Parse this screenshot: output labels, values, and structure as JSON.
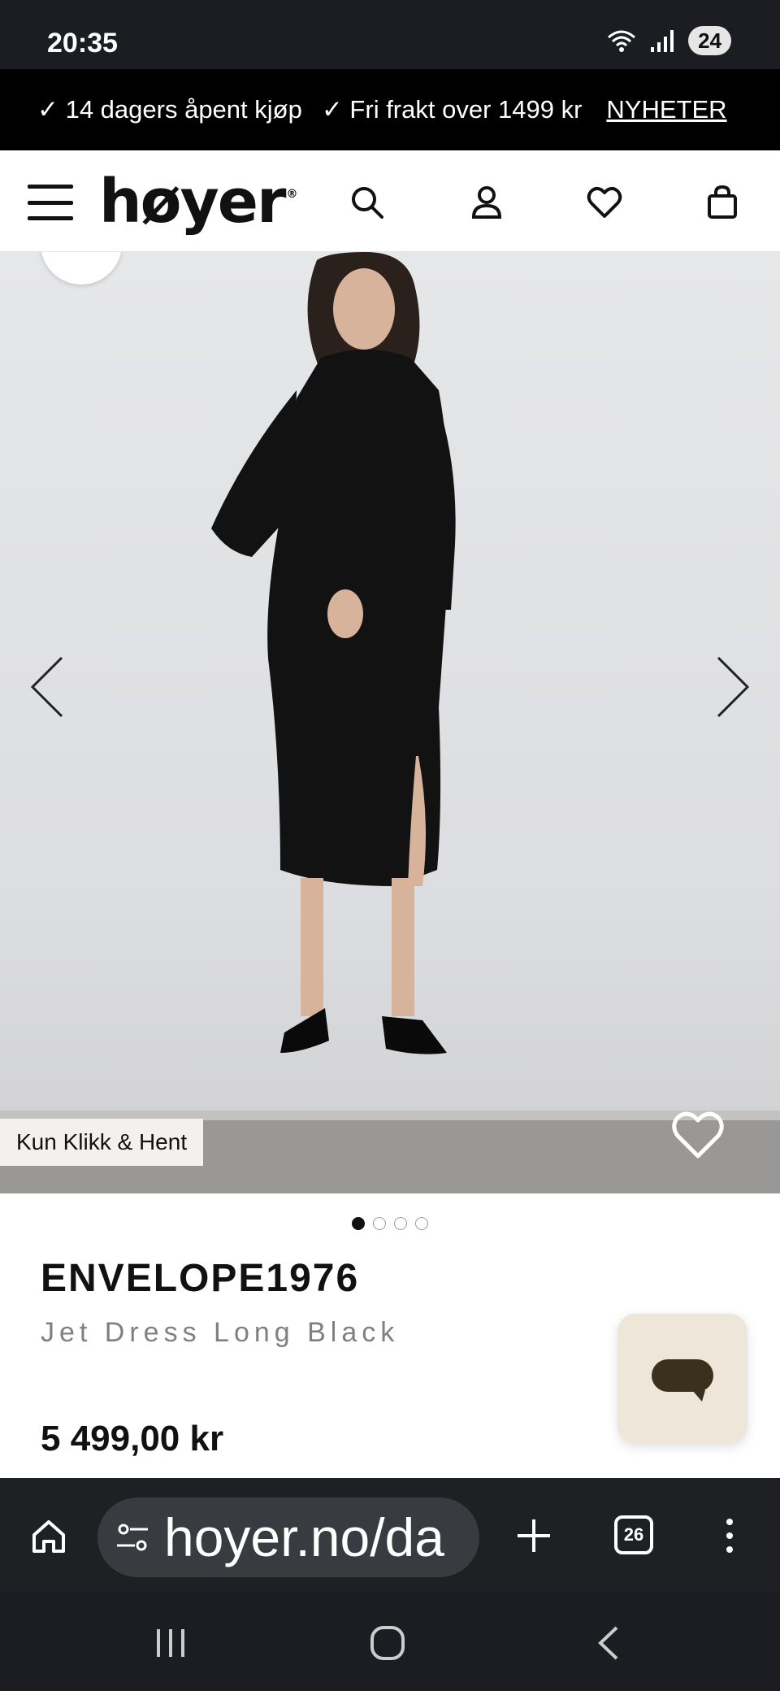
{
  "status_bar": {
    "time": "20:35",
    "battery": "24"
  },
  "announcement": {
    "msg1": "✓ 14 dagers åpent kjøp",
    "msg2": "✓ Fri frakt over 1499 kr",
    "link": "NYHETER"
  },
  "header": {
    "logo": "høyer",
    "logo_mark": "®",
    "icons": [
      "menu-icon",
      "search-icon",
      "account-icon",
      "heart-icon",
      "bag-icon"
    ]
  },
  "product": {
    "badge": "Kun Klikk & Hent",
    "image_count": 4,
    "active_image": 1,
    "brand": "ENVELOPE1976",
    "name": "Jet Dress Long Black",
    "price": "5 499,00 kr"
  },
  "browser": {
    "url": "hoyer.no/da",
    "tab_count": "26"
  },
  "colors": {
    "status_bar_bg": "#1c1d22",
    "announce_bg": "#000000",
    "chat_bg": "#efe6da",
    "chat_icon": "#3b2f1e"
  }
}
